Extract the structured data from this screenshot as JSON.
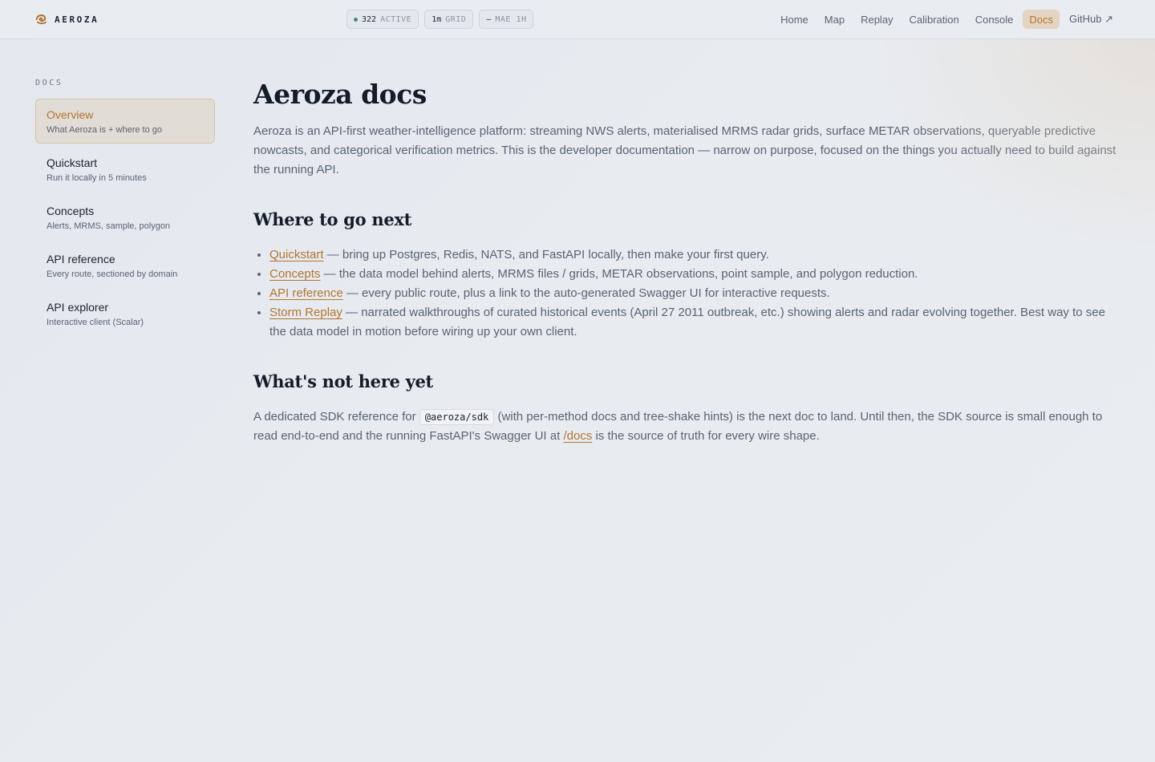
{
  "header": {
    "brand": "AEROZA",
    "brand_icon": "aeroza-swirl-icon",
    "status": {
      "active_count": "322",
      "active_label": "ACTIVE",
      "grid_value": "1m",
      "grid_label": "GRID",
      "mae_value": "—",
      "mae_label": "MAE 1H",
      "active_dot_color": "#4d8a6e"
    },
    "nav": [
      {
        "label": "Home"
      },
      {
        "label": "Map"
      },
      {
        "label": "Replay"
      },
      {
        "label": "Calibration"
      },
      {
        "label": "Console"
      },
      {
        "label": "Docs",
        "active": true
      },
      {
        "label": "GitHub ↗"
      }
    ]
  },
  "sidebar": {
    "heading": "DOCS",
    "items": [
      {
        "title": "Overview",
        "subtitle": "What Aeroza is + where to go",
        "active": true
      },
      {
        "title": "Quickstart",
        "subtitle": "Run it locally in 5 minutes"
      },
      {
        "title": "Concepts",
        "subtitle": "Alerts, MRMS, sample, polygon"
      },
      {
        "title": "API reference",
        "subtitle": "Every route, sectioned by domain"
      },
      {
        "title": "API explorer",
        "subtitle": "Interactive client (Scalar)"
      }
    ]
  },
  "main": {
    "title": "Aeroza docs",
    "intro": "Aeroza is an API-first weather-intelligence platform: streaming NWS alerts, materialised MRMS radar grids, surface METAR observations, queryable predictive nowcasts, and categorical verification metrics. This is the developer documentation — narrow on purpose, focused on the things you actually need to build against the running API.",
    "next_heading": "Where to go next",
    "next_items": [
      {
        "link": "Quickstart",
        "text": " — bring up Postgres, Redis, NATS, and FastAPI locally, then make your first query."
      },
      {
        "link": "Concepts",
        "text": " — the data model behind alerts, MRMS files / grids, METAR observations, point sample, and polygon reduction."
      },
      {
        "link": "API reference",
        "text": " — every public route, plus a link to the auto-generated Swagger UI for interactive requests."
      },
      {
        "link": "Storm Replay",
        "text": " — narrated walkthroughs of curated historical events (April 27 2011 outbreak, etc.) showing alerts and radar evolving together. Best way to see the data model in motion before wiring up your own client."
      }
    ],
    "notyet_heading": "What's not here yet",
    "notyet": {
      "before": "A dedicated SDK reference for ",
      "code": "@aeroza/sdk",
      "middle": " (with per-method docs and tree-shake hints) is the next doc to land. Until then, the SDK source is small enough to read end-to-end and the running FastAPI's Swagger UI at ",
      "link": "/docs",
      "after": " is the source of truth for every wire shape."
    }
  },
  "colors": {
    "accent": "#b2752f",
    "active_bg": "#e4d5c3",
    "text": "#1b2230",
    "muted": "#5a6372"
  }
}
